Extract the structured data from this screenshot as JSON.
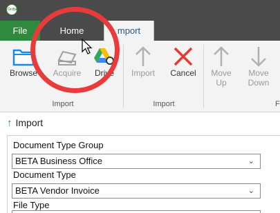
{
  "app": {
    "logo_text": "OnBase"
  },
  "tabs": [
    {
      "label": "File"
    },
    {
      "label": "Home"
    },
    {
      "label": "Import",
      "visible_text": "mport"
    }
  ],
  "ribbon": {
    "groups": [
      {
        "label": "Import",
        "buttons": [
          {
            "label": "Browse",
            "icon": "folder-icon",
            "enabled": true
          },
          {
            "label": "Acquire",
            "icon": "scanner-icon",
            "enabled": false
          },
          {
            "label": "Drive",
            "icon": "google-drive-search-icon",
            "enabled": true
          }
        ]
      },
      {
        "label": "Import",
        "buttons": [
          {
            "label": "Import",
            "icon": "arrow-up-icon",
            "enabled": false
          },
          {
            "label": "Cancel",
            "icon": "red-x-icon",
            "enabled": true
          },
          {
            "label_line1": "Move",
            "label_line2": "Up",
            "icon": "arrow-up-icon",
            "enabled": false
          },
          {
            "label_line1": "Move",
            "label_line2": "Down",
            "icon": "arrow-down-icon",
            "enabled": false
          }
        ]
      }
    ],
    "partial_group_label": "F"
  },
  "panel": {
    "title": "Import",
    "fields": [
      {
        "label": "Document Type Group",
        "value": "BETA Business Office"
      },
      {
        "label": "Document Type",
        "value": "BETA Vendor Invoice"
      },
      {
        "label": "File Type"
      }
    ]
  },
  "colors": {
    "titlebar": "#4a4a4a",
    "file_tab": "#2f8a3d",
    "ribbon_bg": "#f3f3f3",
    "highlight_ring": "#e83b3b",
    "cancel_x": "#e53935",
    "import_arrow": "#2f8a3d"
  }
}
